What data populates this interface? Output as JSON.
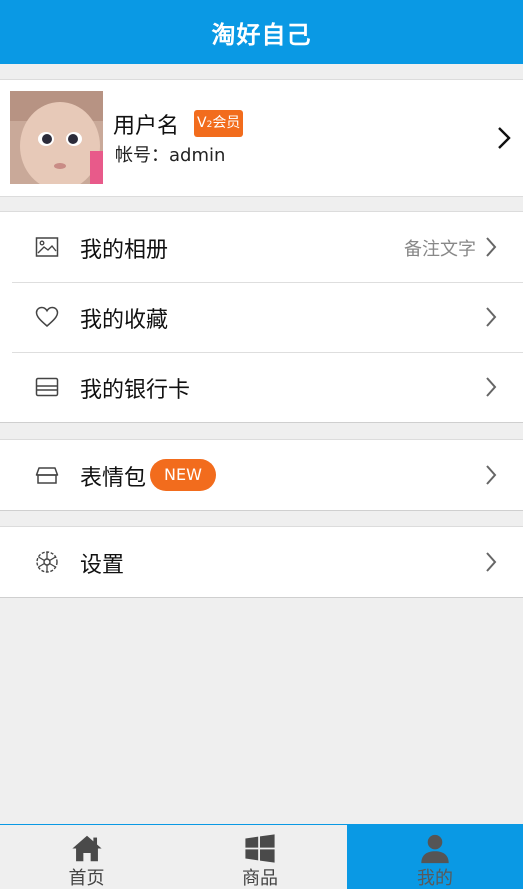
{
  "header": {
    "title": "淘好自己"
  },
  "profile": {
    "username": "用户名",
    "vip_badge_main": "V",
    "vip_badge_sub": "2",
    "vip_badge_suffix": "会员",
    "account": "帐号：admin"
  },
  "menu": {
    "album": {
      "label": "我的相册",
      "note": "备注文字",
      "icon": "image-icon"
    },
    "favorites": {
      "label": "我的收藏",
      "icon": "heart-icon"
    },
    "bank_card": {
      "label": "我的银行卡",
      "icon": "card-icon"
    },
    "stickers": {
      "label": "表情包",
      "badge": "NEW",
      "icon": "box-icon"
    },
    "settings": {
      "label": "设置",
      "icon": "gear-icon"
    }
  },
  "tabs": [
    {
      "label": "首页",
      "icon": "home-icon",
      "active": false
    },
    {
      "label": "商品",
      "icon": "windows-grid-icon",
      "active": false
    },
    {
      "label": "我的",
      "icon": "user-icon",
      "active": true
    }
  ],
  "colors": {
    "primary": "#0a99e4",
    "accent": "#f26c1d",
    "background": "#efefef"
  }
}
